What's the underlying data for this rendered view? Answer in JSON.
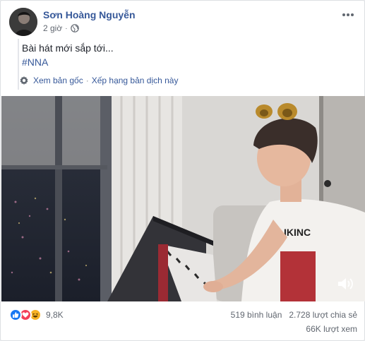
{
  "post": {
    "author": "Sơn Hoàng Nguyễn",
    "time": "2 giờ",
    "separator": "·",
    "text_line1": "Bài hát mới sắp tới...",
    "hashtag": "#NNA",
    "translate": {
      "original": "Xem bản gốc",
      "separator": "·",
      "rate": "Xếp hạng bản dịch này"
    }
  },
  "reactions": {
    "icons": [
      "like-icon",
      "love-icon",
      "haha-icon"
    ],
    "count": "9,8K"
  },
  "stats": {
    "comments": "519 bình luận",
    "shares": "2.728 lượt chia sẻ",
    "views": "66K lượt xem"
  },
  "colors": {
    "link": "#365899",
    "secondary": "#616770",
    "like": "#1877f2",
    "love": "#f33e58",
    "haha": "#f7b125"
  }
}
